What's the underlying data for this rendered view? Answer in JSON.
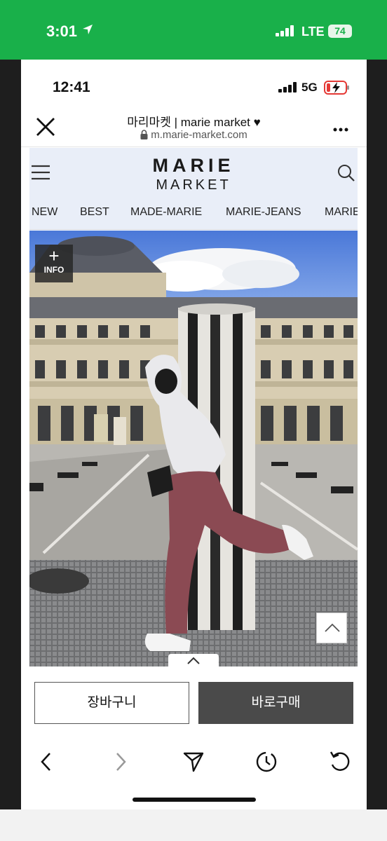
{
  "outer_status": {
    "time": "3:01",
    "network": "LTE",
    "battery": "74"
  },
  "inner_status": {
    "time": "12:41",
    "network": "5G"
  },
  "browser": {
    "page_title": "마리마켓 | marie market ♥",
    "url": "m.marie-market.com"
  },
  "site": {
    "logo_line1": "MARIE",
    "logo_line2": "MARKET",
    "nav": [
      "NEW",
      "BEST",
      "MADE-MARIE",
      "MARIE-JEANS",
      "MARIE-K"
    ]
  },
  "product_image": {
    "info_plus": "+",
    "info_label": "INFO"
  },
  "actions": {
    "cart_label": "장바구니",
    "buy_label": "바로구매"
  },
  "colors": {
    "status_green": "#19b04a",
    "buy_button": "#4a4a4a",
    "header_bg": "#e9eef8"
  }
}
